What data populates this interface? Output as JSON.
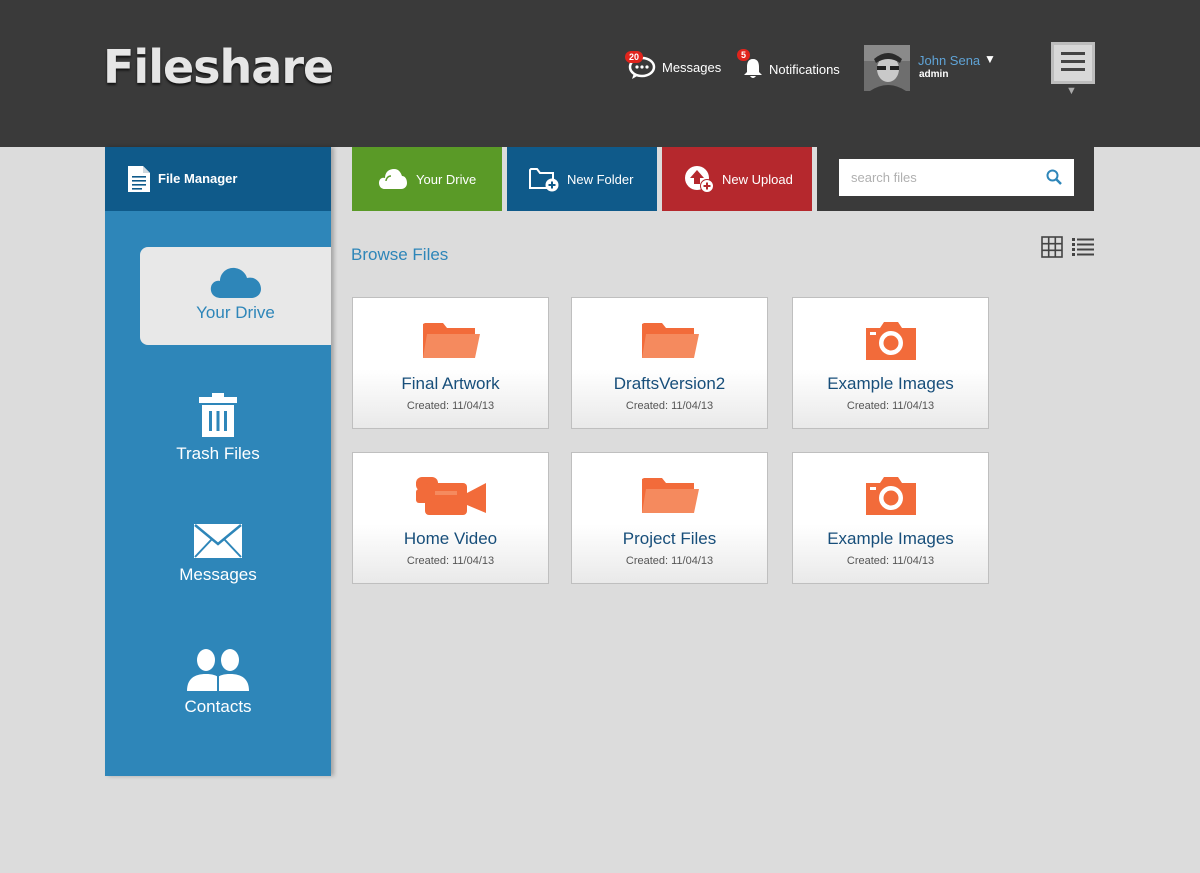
{
  "header": {
    "logo": "Fileshare",
    "messages": {
      "label": "Messages",
      "count": "20"
    },
    "notifications": {
      "label": "Notifications",
      "count": "5"
    },
    "user": {
      "name": "John Sena",
      "role": "admin"
    }
  },
  "sidebar": {
    "title": "File Manager",
    "items": [
      {
        "label": "Your Drive",
        "icon": "cloud-icon",
        "active": true
      },
      {
        "label": "Trash Files",
        "icon": "trash-icon"
      },
      {
        "label": "Messages",
        "icon": "envelope-icon"
      },
      {
        "label": "Contacts",
        "icon": "contacts-icon"
      }
    ]
  },
  "toolbar": {
    "your_drive": "Your Drive",
    "new_folder": "New Folder",
    "new_upload": "New Upload",
    "search_placeholder": "search files"
  },
  "browse": {
    "title": "Browse Files",
    "files": [
      {
        "name": "Final Artwork",
        "created": "Created: 11/04/13",
        "icon": "folder-icon"
      },
      {
        "name": "DraftsVersion2",
        "created": "Created: 11/04/13",
        "icon": "folder-icon"
      },
      {
        "name": "Example Images",
        "created": "Created: 11/04/13",
        "icon": "camera-icon"
      },
      {
        "name": "Home Video",
        "created": "Created: 11/04/13",
        "icon": "video-camera-icon"
      },
      {
        "name": "Project Files",
        "created": "Created: 11/04/13",
        "icon": "folder-icon"
      },
      {
        "name": "Example Images",
        "created": "Created: 11/04/13",
        "icon": "camera-icon"
      }
    ]
  },
  "colors": {
    "header_bg": "#3a3a3a",
    "sidebar_bg": "#2e86b9",
    "drive_green": "#5a9a27",
    "folder_blue": "#0f5a8a",
    "upload_red": "#b5282d",
    "icon_orange": "#f26b3a"
  }
}
